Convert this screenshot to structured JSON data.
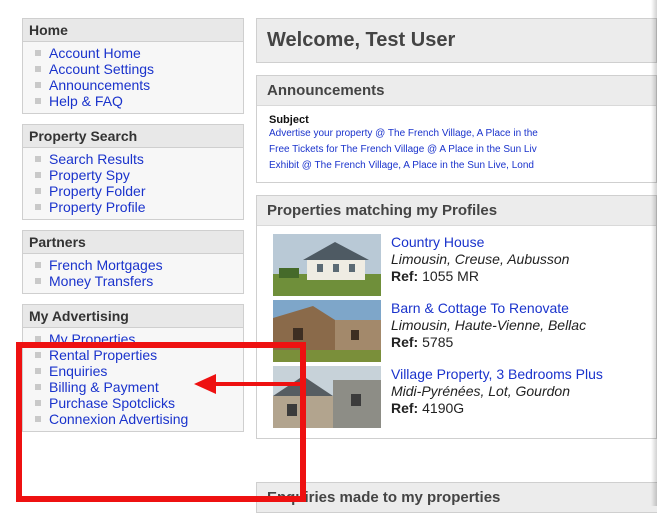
{
  "sidebar": {
    "home": {
      "title": "Home",
      "items": [
        "Account Home",
        "Account Settings",
        "Announcements",
        "Help & FAQ"
      ]
    },
    "property_search": {
      "title": "Property Search",
      "items": [
        "Search Results",
        "Property Spy",
        "Property Folder",
        "Property Profile"
      ]
    },
    "partners": {
      "title": "Partners",
      "items": [
        "French Mortgages",
        "Money Transfers"
      ]
    },
    "my_advertising": {
      "title": "My Advertising",
      "items": [
        "My Properties",
        "Rental Properties",
        "Enquiries",
        "Billing & Payment",
        "Purchase Spotclicks",
        "Connexion Advertising"
      ]
    }
  },
  "main": {
    "welcome": "Welcome, Test User",
    "announcements": {
      "title": "Announcements",
      "subject_label": "Subject",
      "links": [
        "Advertise your property @ The French Village, A Place in the",
        "Free Tickets for The French Village @ A Place in the Sun Liv",
        "Exhibit @ The French Village, A Place in the Sun Live, Lond"
      ]
    },
    "properties": {
      "title": "Properties matching my Profiles",
      "ref_label": "Ref:",
      "items": [
        {
          "title": "Country House",
          "location": "Limousin, Creuse, Aubusson",
          "ref": "1055 MR"
        },
        {
          "title": "Barn & Cottage To Renovate",
          "location": "Limousin, Haute-Vienne, Bellac",
          "ref": "5785"
        },
        {
          "title": "Village Property, 3 Bedrooms Plus",
          "location": "Midi-Pyrénées, Lot, Gourdon",
          "ref": "4190G"
        }
      ]
    },
    "enquiries_title": "Enquiries made to my properties"
  },
  "colors": {
    "highlight": "#ee1111",
    "link": "#1a33cc"
  }
}
